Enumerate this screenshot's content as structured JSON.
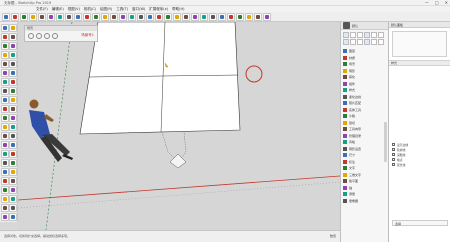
{
  "window": {
    "title": "无标题 - SketchUp Pro 2019",
    "controls": [
      "—",
      "□",
      "✕"
    ]
  },
  "menubar": {
    "items": [
      "文件(F)",
      "编辑(E)",
      "视图(V)",
      "相机(C)",
      "绘图(R)",
      "工具(T)",
      "窗口(W)",
      "扩展程序(x)",
      "帮助(H)"
    ]
  },
  "scene_tab": {
    "title": "场景",
    "name": "场景号1"
  },
  "right_panel": {
    "header": "默认",
    "items": [
      "图层",
      "材质",
      "场景",
      "阴影",
      "雾化",
      "组件",
      "样式",
      "柔化边线",
      "照片匹配",
      "实体工具",
      "沙箱",
      "剖切",
      "工具向导",
      "管理目录",
      "风格",
      "阴影设置",
      "尺寸",
      "标注",
      "文字",
      "三维文字",
      "截平面",
      "轴",
      "测量",
      "量角器"
    ]
  },
  "tray": {
    "header": "默认面板",
    "section": "样式",
    "checks": [
      "显示边线",
      "轮廓线",
      "深粗线",
      "端点",
      "延长线"
    ],
    "bottom_label": "选择"
  },
  "statusbar": {
    "text": "选择对象。切换到扩充选择。拖动鼠标选择多项。",
    "measure": "数值"
  },
  "colors": {
    "accent": "#c0392b",
    "axis_red": "#c0392b",
    "axis_green": "#2e7d32",
    "axis_blue": "#1f4fa3"
  }
}
